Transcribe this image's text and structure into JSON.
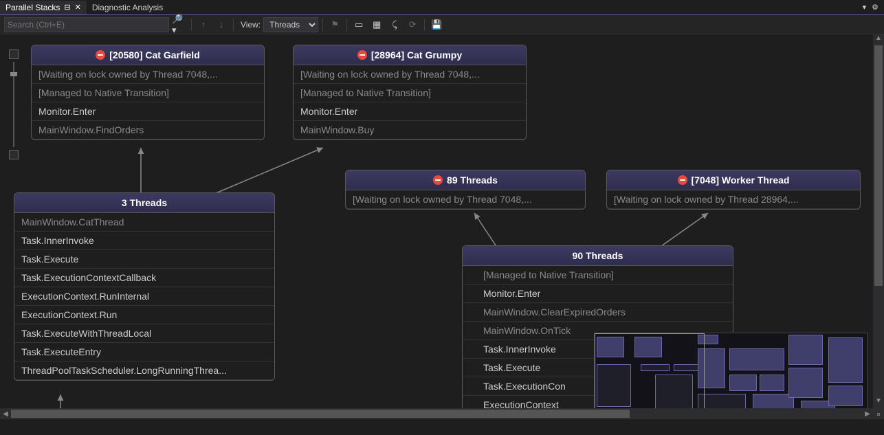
{
  "tabs": {
    "active": "Parallel Stacks",
    "inactive": "Diagnostic Analysis"
  },
  "toolbar": {
    "search_placeholder": "Search (Ctrl+E)",
    "view_label": "View:",
    "view_value": "Threads"
  },
  "nodes": {
    "cat_garfield": {
      "title": "[20580] Cat Garfield",
      "frames": [
        {
          "t": "[Waiting on lock owned by Thread 7048,...",
          "dim": true
        },
        {
          "t": "[Managed to Native Transition]",
          "dim": true
        },
        {
          "t": "Monitor.Enter",
          "dim": false
        },
        {
          "t": "MainWindow.FindOrders",
          "dim": true
        }
      ]
    },
    "cat_grumpy": {
      "title": "[28964] Cat Grumpy",
      "frames": [
        {
          "t": "[Waiting on lock owned by Thread 7048,...",
          "dim": true
        },
        {
          "t": "[Managed to Native Transition]",
          "dim": true
        },
        {
          "t": "Monitor.Enter",
          "dim": false
        },
        {
          "t": "MainWindow.Buy",
          "dim": true
        }
      ]
    },
    "threads3": {
      "title": "3 Threads",
      "frames": [
        {
          "t": "MainWindow.CatThread",
          "dim": true
        },
        {
          "t": "Task.InnerInvoke",
          "dim": false
        },
        {
          "t": "Task.Execute",
          "dim": false
        },
        {
          "t": "Task.ExecutionContextCallback",
          "dim": false
        },
        {
          "t": "ExecutionContext.RunInternal",
          "dim": false
        },
        {
          "t": "ExecutionContext.Run",
          "dim": false
        },
        {
          "t": "Task.ExecuteWithThreadLocal",
          "dim": false
        },
        {
          "t": "Task.ExecuteEntry",
          "dim": false
        },
        {
          "t": "ThreadPoolTaskScheduler.LongRunningThrea...",
          "dim": false
        }
      ]
    },
    "threads89": {
      "title": "89 Threads",
      "frames": [
        {
          "t": "[Waiting on lock owned by Thread 7048,...",
          "dim": true
        }
      ]
    },
    "worker7048": {
      "title": "[7048] Worker Thread",
      "frames": [
        {
          "t": "[Waiting on lock owned by Thread 28964,...",
          "dim": true
        }
      ]
    },
    "threads90": {
      "title": "90 Threads",
      "frames": [
        {
          "t": "[Managed to Native Transition]",
          "dim": true,
          "sub": true
        },
        {
          "t": "Monitor.Enter",
          "dim": false,
          "sub": true
        },
        {
          "t": "MainWindow.ClearExpiredOrders",
          "dim": true,
          "sub": true
        },
        {
          "t": "MainWindow.OnTick",
          "dim": true,
          "sub": true
        },
        {
          "t": "Task.InnerInvoke",
          "dim": false,
          "sub": true
        },
        {
          "t": "Task.Execute",
          "dim": false,
          "sub": true
        },
        {
          "t": "Task.ExecutionCon",
          "dim": false,
          "sub": true
        },
        {
          "t": "ExecutionContext",
          "dim": false,
          "sub": true
        }
      ]
    }
  }
}
